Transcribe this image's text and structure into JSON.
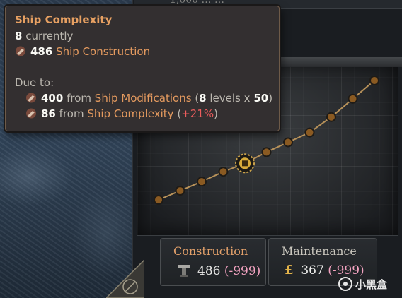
{
  "header": {
    "partial_text": "1,000 … …"
  },
  "tooltip": {
    "title": "Ship Complexity",
    "current_value": "8",
    "current_label": "currently",
    "cost_value": "486",
    "cost_label": "Ship Construction",
    "due_to_label": "Due to:",
    "entries": [
      {
        "icon": "hammer-icon",
        "amount": "400",
        "from": "from",
        "source": "Ship Modifications",
        "paren_open": "(",
        "levels": "8",
        "levels_text": "levels x",
        "multiplier": "50",
        "paren_close": ")"
      },
      {
        "icon": "hammer-icon",
        "amount": "86",
        "from": "from",
        "source": "Ship Complexity",
        "paren_open": "(",
        "percent": "+21%",
        "paren_close": ")"
      }
    ]
  },
  "chart_data": {
    "type": "line",
    "title": "",
    "xlabel": "",
    "ylabel": "",
    "x": [
      1,
      2,
      3,
      4,
      5,
      6,
      7,
      8,
      9,
      10,
      11
    ],
    "values": [
      0,
      1.3,
      2.6,
      4.0,
      5.2,
      6.8,
      8.2,
      9.6,
      11.8,
      14.4,
      17.0
    ],
    "ylim": [
      0,
      17
    ],
    "grid": true,
    "current_index": 4,
    "marker_icon": "coin-stack-icon",
    "line_color": "#b8925a",
    "marker_color": "#8a5a22"
  },
  "panels": {
    "construction": {
      "title": "Construction",
      "icon": "hammer-anvil-icon",
      "value": "486",
      "delta": "(-999)"
    },
    "maintenance": {
      "title": "Maintenance",
      "icon": "pound-icon",
      "symbol": "£",
      "value": "367",
      "delta": "(-999)"
    }
  },
  "watermark": {
    "text": "小黑盒",
    "icon": "heybox-logo-icon"
  },
  "colors": {
    "accent_orange": "#e49a5f",
    "negative_red": "#ee5d5d",
    "delta_pink": "#f2a2c0"
  }
}
